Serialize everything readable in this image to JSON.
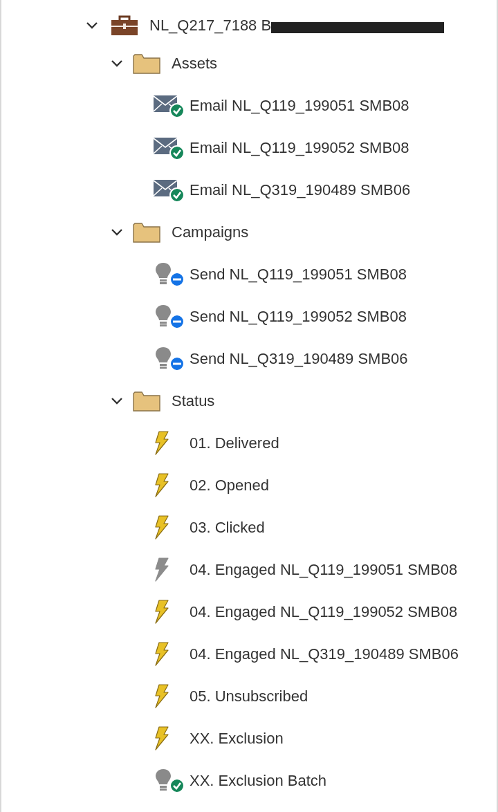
{
  "tree": {
    "label": "NL_Q217_7188 B",
    "expanded": true,
    "redacted": true,
    "children": [
      {
        "label": "Assets",
        "expanded": true,
        "children": [
          {
            "label": "Email NL_Q119_199051 SMB08",
            "kind": "email",
            "approved": true
          },
          {
            "label": "Email NL_Q119_199052 SMB08",
            "kind": "email",
            "approved": true
          },
          {
            "label": "Email NL_Q319_190489 SMB06",
            "kind": "email",
            "approved": true
          }
        ]
      },
      {
        "label": "Campaigns",
        "expanded": true,
        "children": [
          {
            "label": "Send NL_Q119_199051 SMB08",
            "kind": "campaign",
            "approved": false
          },
          {
            "label": "Send NL_Q119_199052 SMB08",
            "kind": "campaign",
            "approved": false
          },
          {
            "label": "Send NL_Q319_190489 SMB06",
            "kind": "campaign",
            "approved": false
          }
        ]
      },
      {
        "label": "Status",
        "expanded": true,
        "children": [
          {
            "label": "01. Delivered",
            "kind": "trigger",
            "active": true
          },
          {
            "label": "02. Opened",
            "kind": "trigger",
            "active": true
          },
          {
            "label": "03. Clicked",
            "kind": "trigger",
            "active": true
          },
          {
            "label": "04. Engaged NL_Q119_199051 SMB08",
            "kind": "trigger",
            "active": false
          },
          {
            "label": "04. Engaged NL_Q119_199052 SMB08",
            "kind": "trigger",
            "active": true
          },
          {
            "label": "04. Engaged NL_Q319_190489 SMB06",
            "kind": "trigger",
            "active": true
          },
          {
            "label": "05. Unsubscribed",
            "kind": "trigger",
            "active": true
          },
          {
            "label": "XX. Exclusion",
            "kind": "trigger",
            "active": true
          },
          {
            "label": "XX. Exclusion Batch",
            "kind": "campaign",
            "approved": true
          }
        ]
      }
    ]
  }
}
